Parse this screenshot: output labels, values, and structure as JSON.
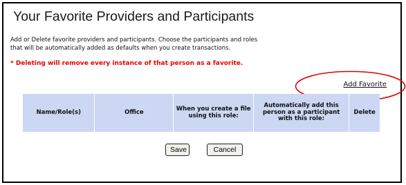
{
  "page": {
    "title": "Your Favorite Providers and Participants",
    "intro_line_1": "Add or Delete favorite providers and participants. Choose the participants and roles",
    "intro_line_2": "that will be automatically added as defaults when you create transactions.",
    "warning": "* Deleting will remove every instance of that person as a favorite."
  },
  "actions": {
    "add_favorite_label": "Add Favorite",
    "save_label": "Save",
    "cancel_label": "Cancel"
  },
  "table": {
    "columns": [
      "Name/Role(s)",
      "Office",
      "When you create a file using this role:",
      "Automatically add this person as a participant with this role:",
      "Delete"
    ]
  },
  "colors": {
    "header_bg": "#ccd7f3",
    "warning_text": "#e40000",
    "highlight_oval": "#e00000"
  }
}
